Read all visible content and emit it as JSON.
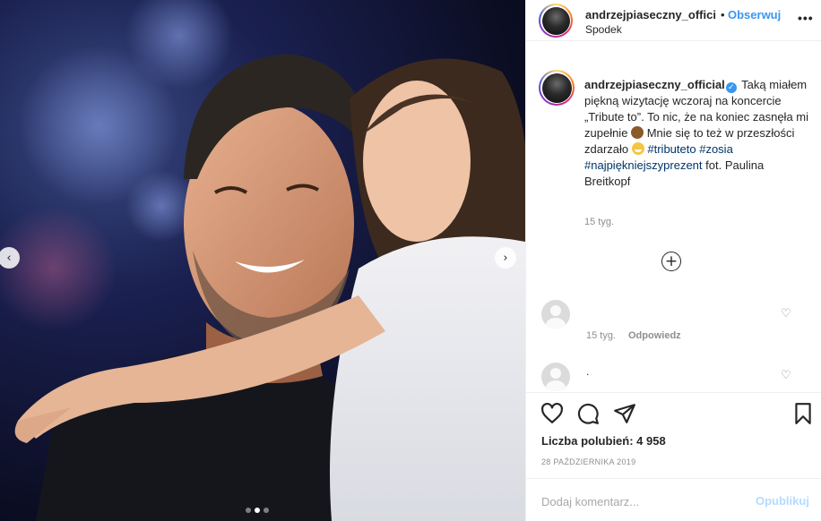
{
  "post": {
    "username": "andrzejpiaseczny_offici",
    "follow_separator": "•",
    "follow_label": "Obserwuj",
    "location": "Spodek",
    "more_icon": "more-horizontal-icon"
  },
  "caption": {
    "username": "andrzejpiaseczny_official",
    "text_part1": "Taką miałem piękną wizytację wczoraj na koncercie „Tribute to”. To nic, że na koniec zasnęła mi zupełnie",
    "text_part2": "Mnie się to też w przeszłości zdarzało",
    "hashtag1": "#tributeto",
    "hashtag2": "#zosia",
    "hashtag3": "#najpiękniejszyprezent",
    "text_part3": "fot. Paulina Breitkopf",
    "time": "15 tyg."
  },
  "comments": [
    {
      "text": "",
      "time": "15 tyg.",
      "reply_label": "Odpowiedz"
    },
    {
      "text": "."
    }
  ],
  "stats": {
    "likes": "Liczba polubień: 4 958",
    "date": "28 PAŹDZIERNIKA 2019"
  },
  "comment_box": {
    "placeholder": "Dodaj komentarz...",
    "post_label": "Opublikuj"
  },
  "carousel": {
    "slide_count": 3,
    "active_index": 1
  },
  "colors": {
    "accent": "#3897f0",
    "hashtag": "#003569",
    "muted": "#8e8e8e"
  }
}
